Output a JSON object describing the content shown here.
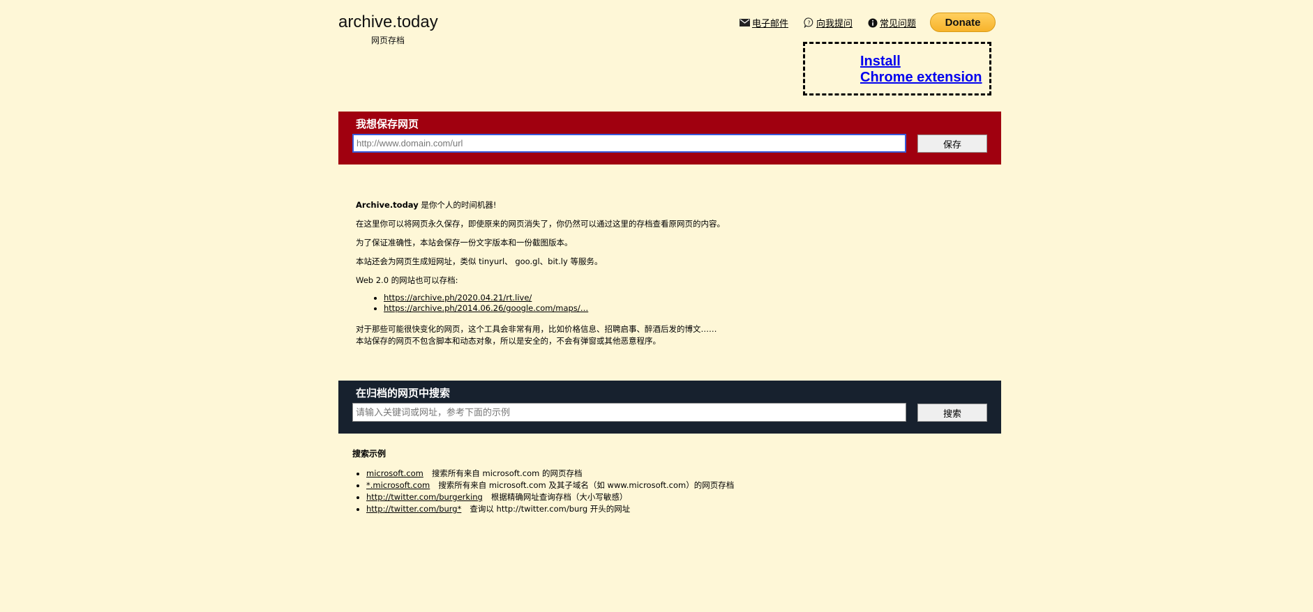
{
  "header": {
    "title": "archive.today",
    "subtitle": "网页存档",
    "links": [
      {
        "label": "电子邮件",
        "icon": "envelope-icon"
      },
      {
        "label": "向我提问",
        "icon": "question-bubble-icon"
      },
      {
        "label": "常见问题",
        "icon": "info-icon"
      }
    ],
    "donate_label": "Donate"
  },
  "extension": {
    "line1": "Install",
    "line2": "Chrome extension"
  },
  "save_panel": {
    "title": "我想保存网页",
    "placeholder": "http://www.domain.com/url",
    "button": "保存"
  },
  "about": {
    "brand": "Archive.today",
    "intro_rest": " 是你个人的时间机器!",
    "line2": "在这里你可以将网页永久保存，即使原来的网页消失了，你仍然可以通过这里的存档查看原网页的内容。",
    "line3": "为了保证准确性，本站会保存一份文字版本和一份截图版本。",
    "line4": "本站还会为网页生成短网址，类似 tinyurl、 goo.gl、bit.ly 等服务。",
    "line5": "Web 2.0 的网站也可以存档:",
    "examples": [
      "https://archive.ph/2020.04.21/rt.live/",
      "https://archive.ph/2014.06.26/google.com/maps/…"
    ],
    "tail1": "对于那些可能很快变化的网页，这个工具会非常有用，比如价格信息、招聘启事、醉酒后发的博文……",
    "tail2": "本站保存的网页不包含脚本和动态对象，所以是安全的，不会有弹窗或其他恶意程序。"
  },
  "search_panel": {
    "title": "在归档的网页中搜索",
    "placeholder": "请输入关键词或网址，参考下面的示例",
    "button": "搜索"
  },
  "search_examples": {
    "heading": "搜索示例",
    "items": [
      {
        "link": "microsoft.com",
        "desc": "搜索所有来自 microsoft.com 的网页存档"
      },
      {
        "link": "*.microsoft.com",
        "desc": "搜索所有来自 microsoft.com 及其子域名（如 www.microsoft.com）的网页存档"
      },
      {
        "link": "http://twitter.com/burgerking",
        "desc": "根据精确网址查询存档（大小写敏感）"
      },
      {
        "link": "http://twitter.com/burg*",
        "desc": "查询以 http://twitter.com/burg 开头的网址"
      }
    ]
  }
}
